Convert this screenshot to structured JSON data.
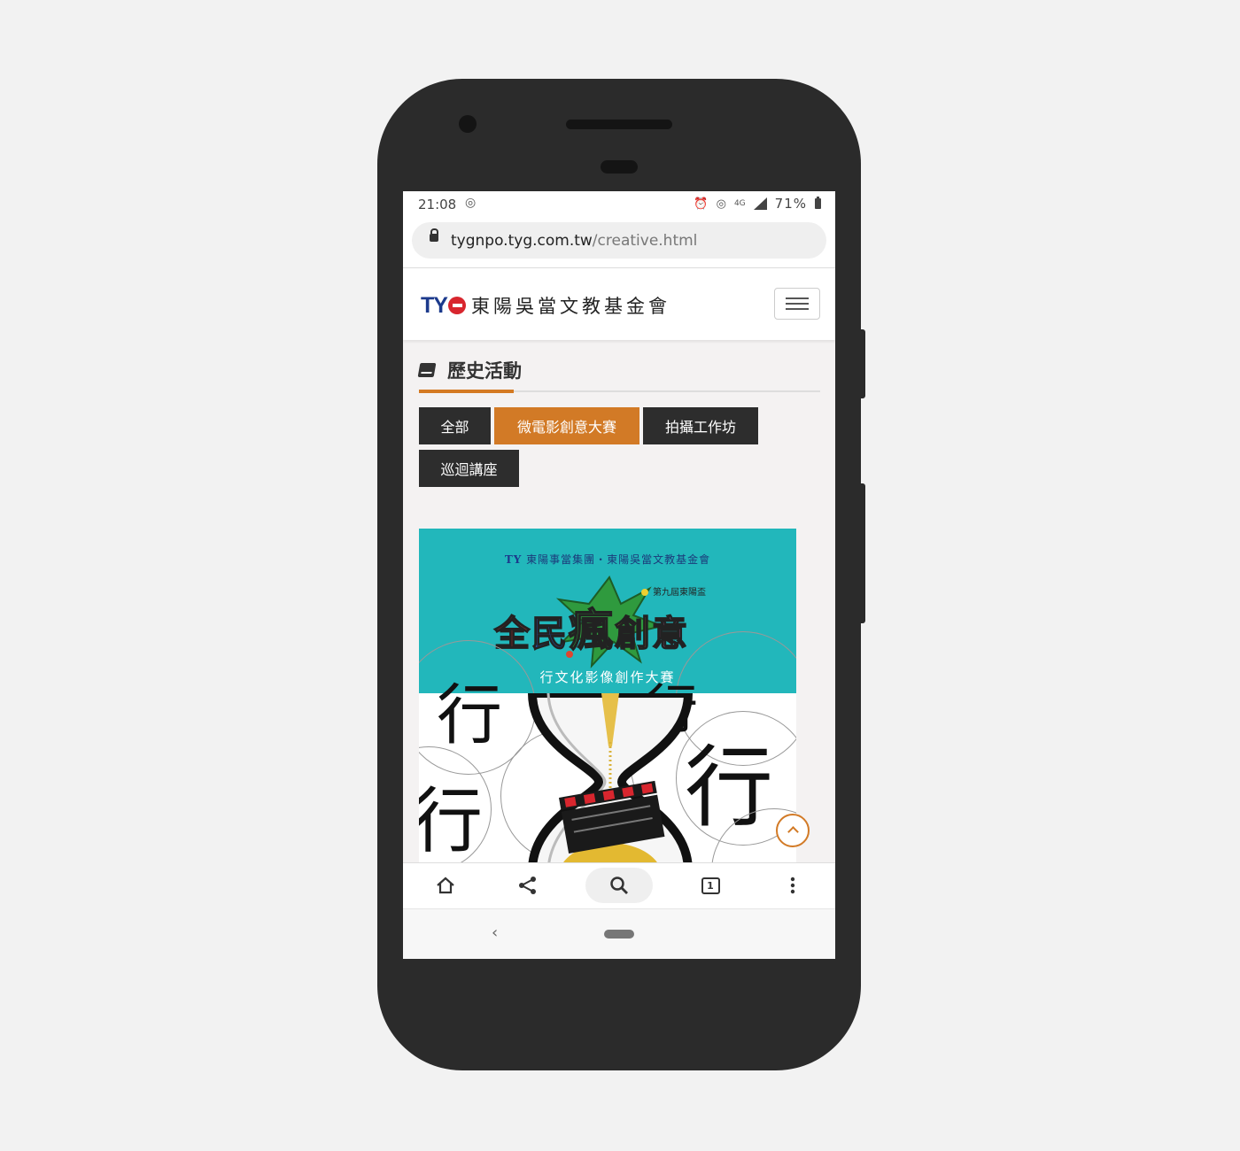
{
  "status_bar": {
    "time": "21:08",
    "network": "4G",
    "battery": "71%",
    "icons": [
      "hotspot-icon",
      "alarm-icon",
      "hotspot-icon",
      "signal-icon",
      "battery-icon"
    ]
  },
  "browser": {
    "url_host": "tygnpo.tyg.com.tw",
    "url_path": "/creative.html",
    "tab_count": "1"
  },
  "site": {
    "logo_mark": "TY",
    "logo_name": "東陽吳當文教基金會"
  },
  "section": {
    "title": "歷史活動"
  },
  "filters": [
    {
      "label": "全部",
      "active": false
    },
    {
      "label": "微電影創意大賽",
      "active": true
    },
    {
      "label": "拍攝工作坊",
      "active": false
    },
    {
      "label": "巡迴講座",
      "active": false
    }
  ],
  "poster": {
    "org_mark": "TY",
    "org_text": "東陽事當集團・東陽吳當文教基金會",
    "edition": "第九屆東陽盃",
    "headline": [
      "全",
      "民",
      "瘋",
      "創",
      "意"
    ],
    "subtitle": "行文化影像創作大賽",
    "glyph": "行"
  },
  "colors": {
    "accent": "#d27a26",
    "button_dark": "#2d2d2d",
    "poster_teal": "#22b7bb",
    "brand_blue": "#1c3a8c",
    "brand_red": "#d8262e"
  }
}
